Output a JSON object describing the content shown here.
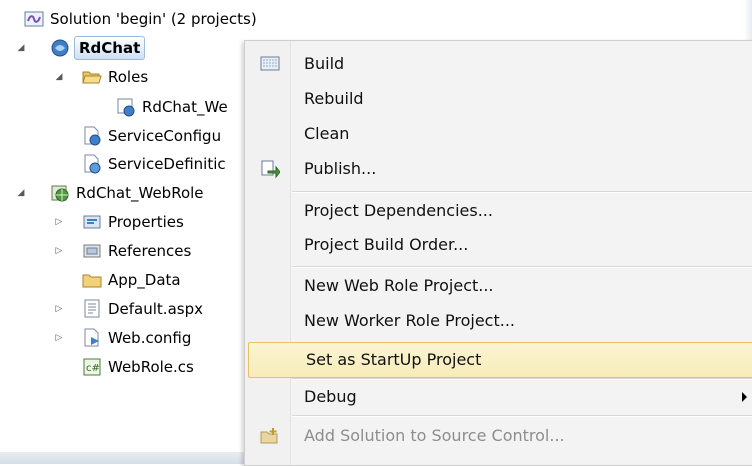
{
  "solution_explorer": {
    "solution_label": "Solution 'begin' (2 projects)",
    "nodes": [
      {
        "label": "RdChat"
      },
      {
        "label": "Roles"
      },
      {
        "label": "RdChat_We"
      },
      {
        "label": "ServiceConfigu"
      },
      {
        "label": "ServiceDefinitic"
      },
      {
        "label": "RdChat_WebRole"
      },
      {
        "label": "Properties"
      },
      {
        "label": "References"
      },
      {
        "label": "App_Data"
      },
      {
        "label": "Default.aspx"
      },
      {
        "label": "Web.config"
      },
      {
        "label": "WebRole.cs"
      }
    ]
  },
  "context_menu": {
    "items": [
      {
        "label": "Build",
        "icon": "build-icon"
      },
      {
        "label": "Rebuild"
      },
      {
        "label": "Clean"
      },
      {
        "label": "Publish...",
        "icon": "publish-icon"
      },
      {
        "label": "Project Dependencies..."
      },
      {
        "label": "Project Build Order..."
      },
      {
        "label": "New Web Role Project..."
      },
      {
        "label": "New Worker Role Project..."
      },
      {
        "label": "Set as StartUp Project",
        "highlighted": true
      },
      {
        "label": "Debug",
        "has_submenu": true
      },
      {
        "label": "Add Solution to Source Control...",
        "icon": "source-control-icon",
        "disabled": true
      }
    ]
  },
  "colors": {
    "highlight_fill": "#f7ecb8",
    "highlight_border": "#e5c365",
    "selection_border": "#9fb9d9"
  }
}
